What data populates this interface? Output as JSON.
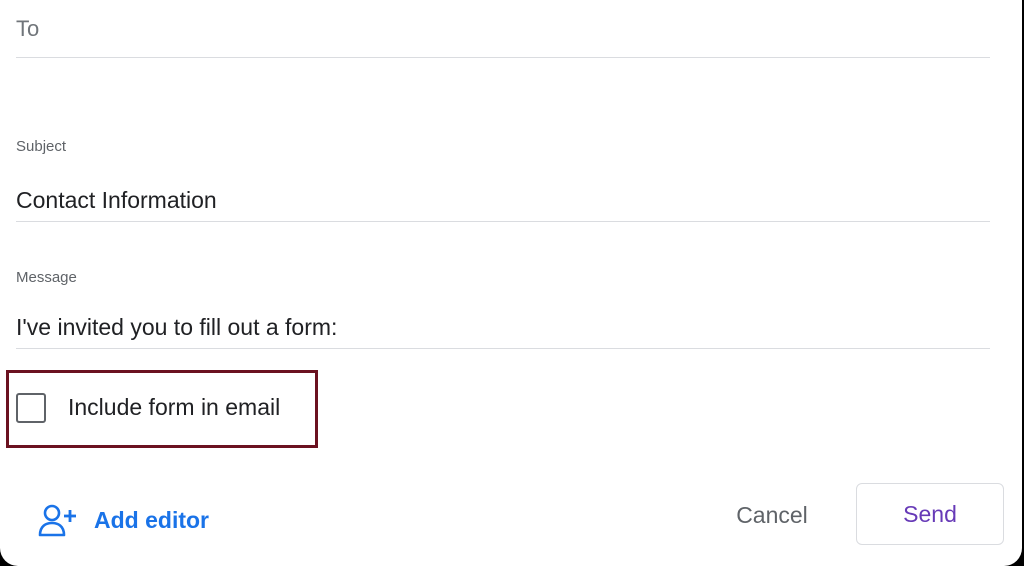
{
  "to": {
    "placeholder": "To"
  },
  "subject": {
    "label": "Subject",
    "value": "Contact Information"
  },
  "message": {
    "label": "Message",
    "value": "I've invited you to fill out a form:"
  },
  "include_form": {
    "label": "Include form in email",
    "checked": false
  },
  "footer": {
    "add_editor_label": "Add editor",
    "add_editor_icon": "person-add-icon",
    "cancel_label": "Cancel",
    "send_label": "Send"
  },
  "colors": {
    "accent_blue": "#1a73e8",
    "send_purple": "#673ab7",
    "highlight_border": "#6b1220"
  }
}
